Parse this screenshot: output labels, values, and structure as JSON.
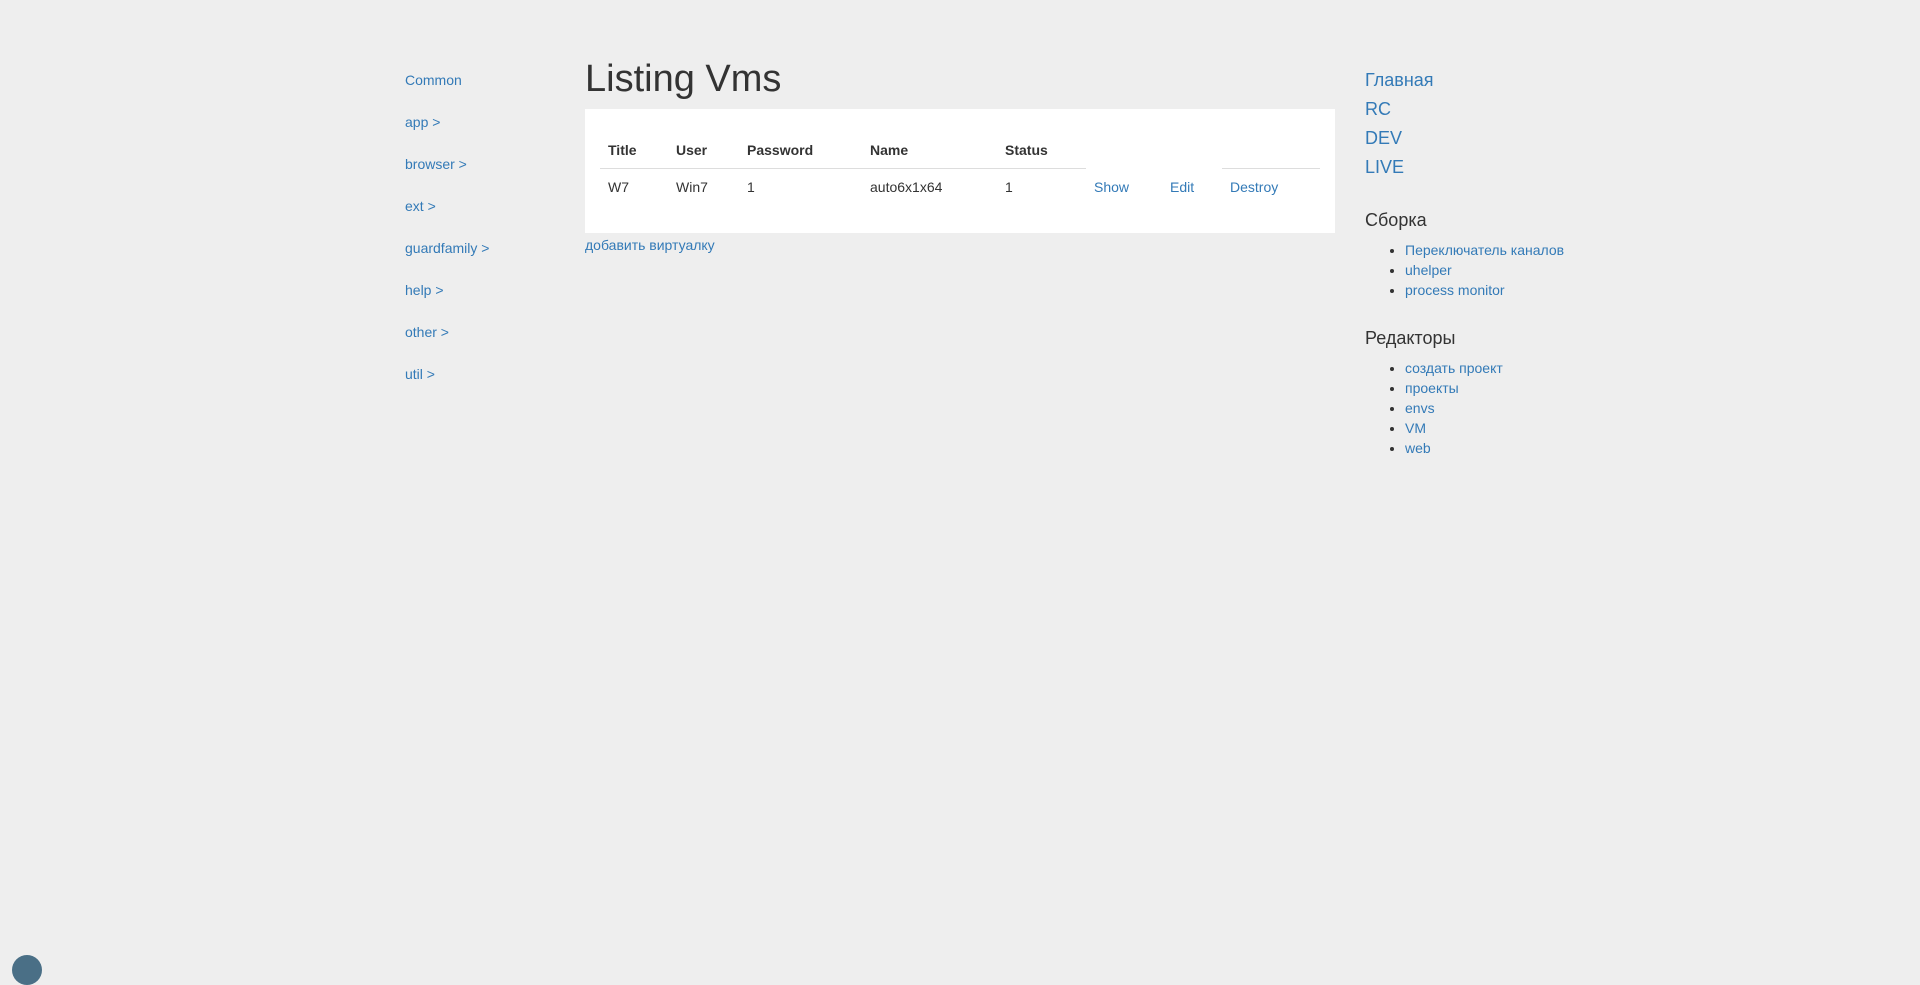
{
  "left_nav": {
    "items": [
      {
        "label": "Common"
      },
      {
        "label": "app >"
      },
      {
        "label": "browser >"
      },
      {
        "label": "ext >"
      },
      {
        "label": "guardfamily >"
      },
      {
        "label": "help >"
      },
      {
        "label": "other >"
      },
      {
        "label": "util >"
      }
    ]
  },
  "main": {
    "title": "Listing Vms",
    "table": {
      "headers": [
        "Title",
        "User",
        "Password",
        "Name",
        "Status"
      ],
      "rows": [
        {
          "title": "W7",
          "user": "Win7",
          "password": "1",
          "name": "auto6x1x64",
          "status": "1",
          "show_label": "Show",
          "edit_label": "Edit",
          "destroy_label": "Destroy"
        }
      ]
    },
    "add_link": "добавить виртуалку"
  },
  "right_nav": {
    "top_links": [
      {
        "label": "Главная"
      },
      {
        "label": "RC"
      },
      {
        "label": "DEV"
      },
      {
        "label": "LIVE"
      }
    ],
    "build": {
      "heading": "Сборка",
      "items": [
        {
          "label": "Переключатель каналов"
        },
        {
          "label": "uhelper"
        },
        {
          "label": "process monitor"
        }
      ]
    },
    "editors": {
      "heading": "Редакторы",
      "items": [
        {
          "label": "создать проект"
        },
        {
          "label": "проекты"
        },
        {
          "label": "envs"
        },
        {
          "label": "VM"
        },
        {
          "label": "web"
        }
      ]
    }
  },
  "colors": {
    "background": "#eeeeee",
    "link": "#337ab7",
    "text": "#333333",
    "panel": "#ffffff"
  }
}
